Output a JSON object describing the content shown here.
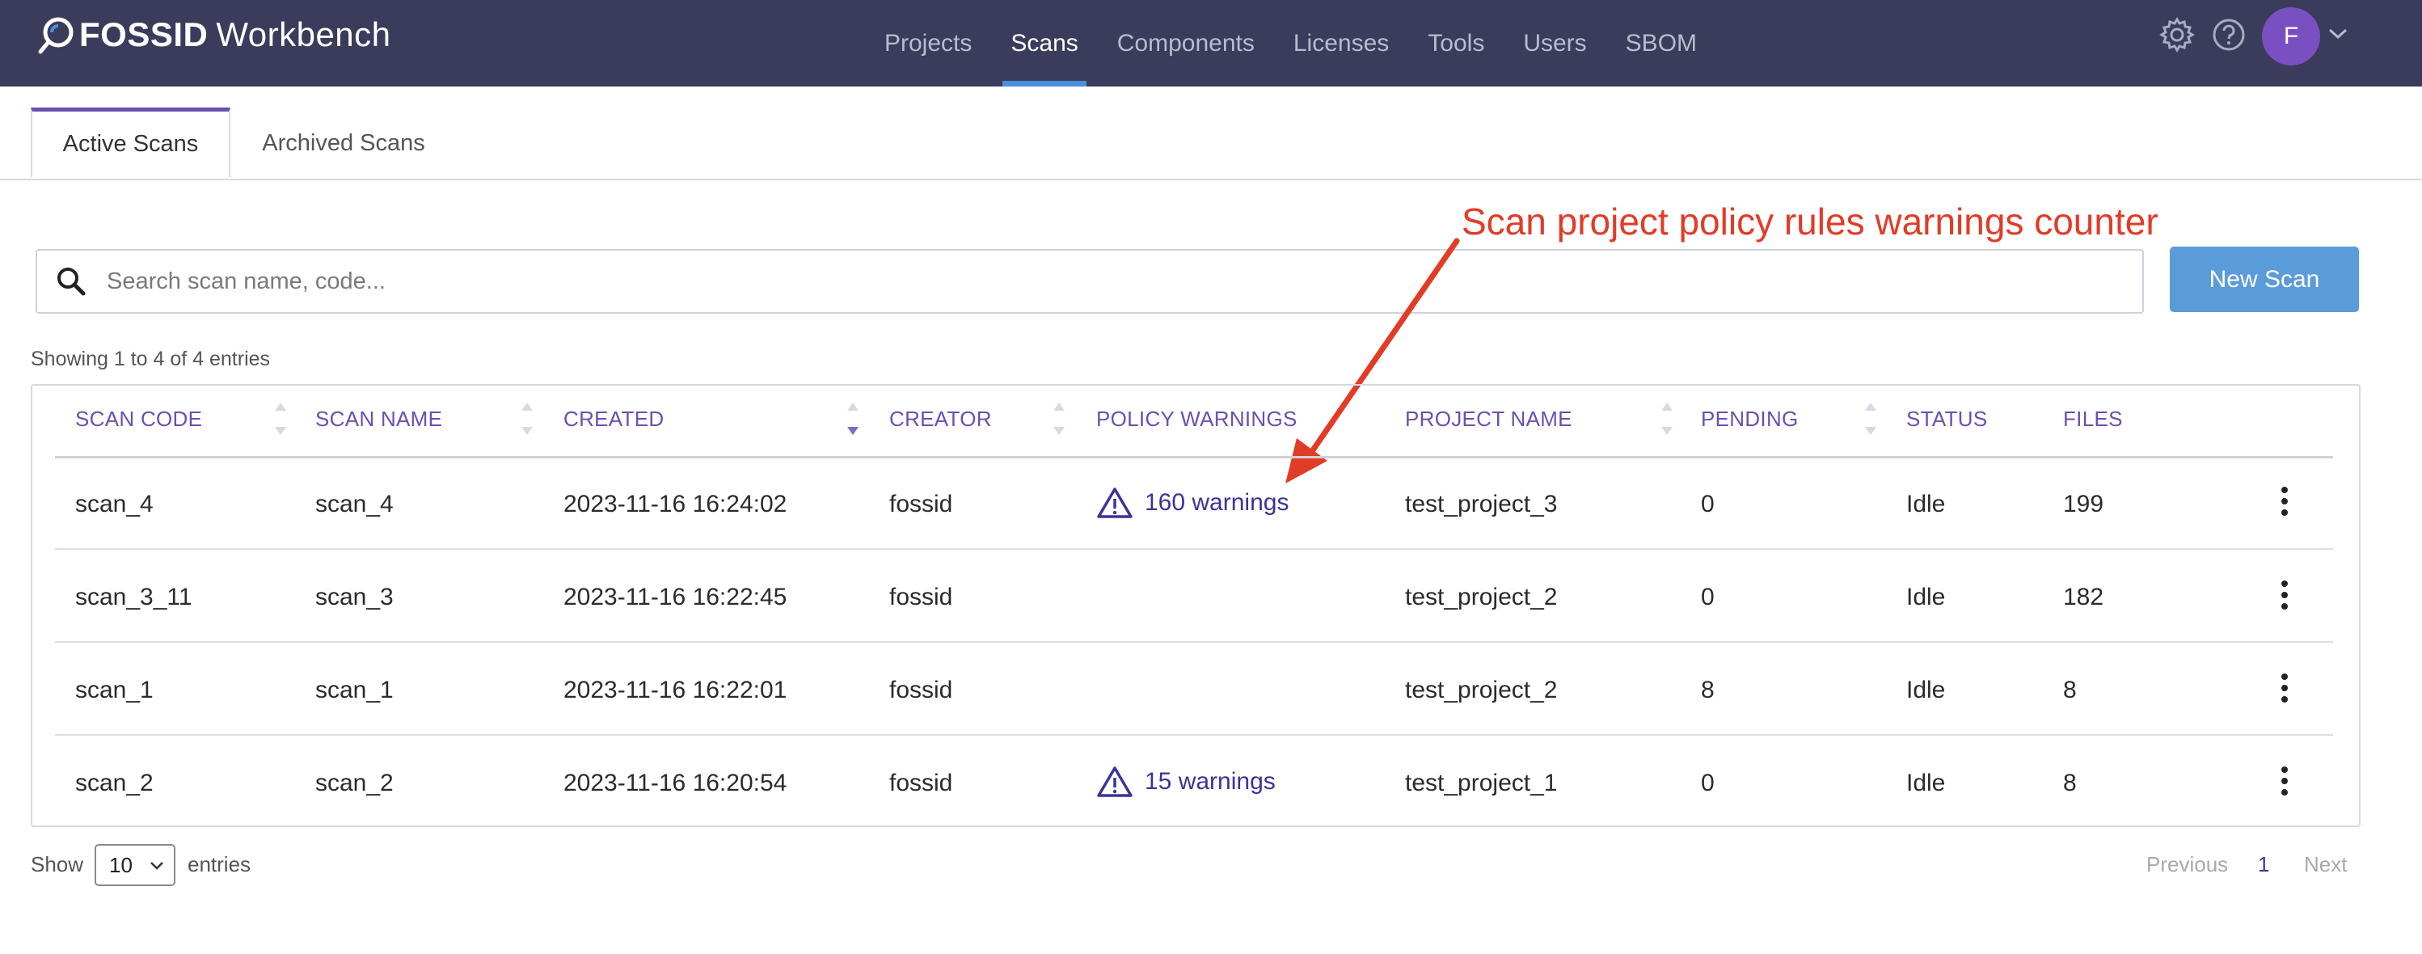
{
  "app": {
    "logo_fossid_text": "FOSSID",
    "logo_product_text": "Workbench"
  },
  "nav": {
    "items": [
      {
        "label": "Projects",
        "active": false
      },
      {
        "label": "Scans",
        "active": true
      },
      {
        "label": "Components",
        "active": false
      },
      {
        "label": "Licenses",
        "active": false
      },
      {
        "label": "Tools",
        "active": false
      },
      {
        "label": "Users",
        "active": false
      },
      {
        "label": "SBOM",
        "active": false
      }
    ],
    "icons": [
      "gear-icon",
      "help-icon"
    ],
    "avatar_letter": "F"
  },
  "tabs": [
    {
      "label": "Active Scans",
      "active": true
    },
    {
      "label": "Archived Scans",
      "active": false
    }
  ],
  "search": {
    "placeholder": "Search scan name, code...",
    "value": ""
  },
  "new_scan_label": "New Scan",
  "annotation": "Scan project policy rules warnings counter",
  "entries_info": "Showing 1 to 4 of 4 entries",
  "table": {
    "columns": [
      "SCAN CODE",
      "SCAN NAME",
      "CREATED",
      "CREATOR",
      "POLICY WARNINGS",
      "PROJECT NAME",
      "PENDING",
      "STATUS",
      "FILES"
    ],
    "rows": [
      {
        "scan_code": "scan_4",
        "scan_name": "scan_4",
        "created": "2023-11-16 16:24:02",
        "creator": "fossid",
        "policy_warnings": "160 warnings",
        "project_name": "test_project_3",
        "pending": "0",
        "status": "Idle",
        "files": "199"
      },
      {
        "scan_code": "scan_3_11",
        "scan_name": "scan_3",
        "created": "2023-11-16 16:22:45",
        "creator": "fossid",
        "policy_warnings": "",
        "project_name": "test_project_2",
        "pending": "0",
        "status": "Idle",
        "files": "182"
      },
      {
        "scan_code": "scan_1",
        "scan_name": "scan_1",
        "created": "2023-11-16 16:22:01",
        "creator": "fossid",
        "policy_warnings": "",
        "project_name": "test_project_2",
        "pending": "8",
        "status": "Idle",
        "files": "8"
      },
      {
        "scan_code": "scan_2",
        "scan_name": "scan_2",
        "created": "2023-11-16 16:20:54",
        "creator": "fossid",
        "policy_warnings": "15 warnings",
        "project_name": "test_project_1",
        "pending": "0",
        "status": "Idle",
        "files": "8"
      }
    ]
  },
  "footer": {
    "show_label": "Show",
    "page_size": "10",
    "entries_label": "entries",
    "previous_label": "Previous",
    "current_page": "1",
    "next_label": "Next"
  },
  "colors": {
    "navbar_bg": "#3b3b5c",
    "accent_blue": "#4a90d9",
    "header_purple": "#6a4fb3",
    "warning_link": "#3a3498",
    "annotation_red": "#e23b26",
    "button_blue": "#5a9bd9"
  }
}
